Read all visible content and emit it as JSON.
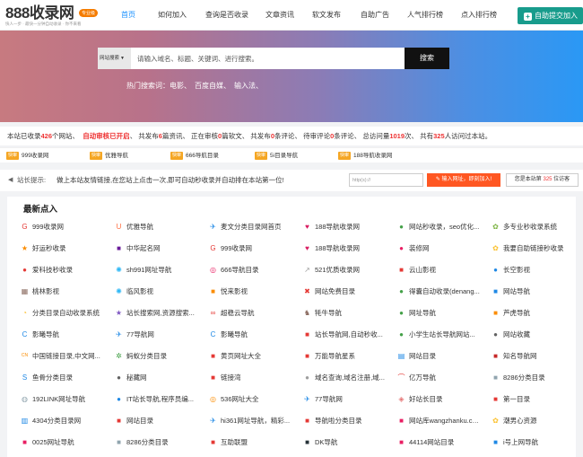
{
  "header": {
    "logo_text": "888收录网",
    "logo_badge": "专业级",
    "logo_slogan": "快人一步 · 最快一分钟自动收录 · 你不来看",
    "nav": [
      "首页",
      "如何加入",
      "查询是否收录",
      "文章资讯",
      "软文发布",
      "自助广告",
      "人气排行榜",
      "点入排行榜"
    ],
    "submit_label": "自助提交加入",
    "accent": "#1890ff",
    "submit_color": "#189c8c"
  },
  "search": {
    "type": "网站搜索",
    "placeholder": "请输入域名、标题、关键词、进行搜索。",
    "button": "搜索",
    "hot_label": "热门搜索词：",
    "hot_terms": [
      "电影、",
      "百度自媒、",
      "输入法、"
    ]
  },
  "stats": {
    "p1": "本站已收录",
    "sites": "426",
    "p2": "个网站、",
    "audit": "自动审核已开启",
    "p3": "、 共发布",
    "articles": "6",
    "p4": "篇资讯、 正在审核",
    "reviewing": "0",
    "p5": "篇软文、 共发布",
    "comments": "0",
    "p6": "条评论、 待审评论",
    "pending": "0",
    "p7": "条评论、 总访问量",
    "visits": "1019",
    "p8": "次、 共有",
    "visitors": "325",
    "p9": "人访问过本站。"
  },
  "strip": [
    {
      "tag": "快审",
      "text": "999收录网"
    },
    {
      "tag": "快审",
      "text": "优雅导航"
    },
    {
      "tag": "快审",
      "text": "666导航目录"
    },
    {
      "tag": "快审",
      "text": "5i目录导航"
    },
    {
      "tag": "快审",
      "text": "188导航收录网"
    }
  ],
  "notice": {
    "label": "站长提示:",
    "text": "做上本站友情链接,在您站上点击一次,即可自动秒收录并自动排在本站第一位!",
    "input_placeholder": "http(s)://",
    "btn": "输入网址，即刻加入!",
    "btn2_a": "您是本站第",
    "btn2_n": "325",
    "btn2_b": "位访客"
  },
  "latest": {
    "title": "最新点入",
    "items": [
      {
        "text": "999收录网",
        "icon": "g-icon",
        "color": "#e53935"
      },
      {
        "text": "优雅导航",
        "icon": "u-icon",
        "color": "#ff7043"
      },
      {
        "text": "麦文分类目录网首页",
        "icon": "plane-icon",
        "color": "#1e88e5"
      },
      {
        "text": "188导航收录网",
        "icon": "heart-icon",
        "color": "#d81b60"
      },
      {
        "text": "网站秒收录，seo优化...",
        "icon": "circle-icon",
        "color": "#43a047"
      },
      {
        "text": "多专业秒收录系统",
        "icon": "leaf-icon",
        "color": "#7cb342"
      },
      {
        "text": "好运秒收录",
        "icon": "star-icon",
        "color": "#fb8c00"
      },
      {
        "text": "中华起名网",
        "icon": "square-icon",
        "color": "#6a1b9a"
      },
      {
        "text": "999收录网",
        "icon": "g-icon",
        "color": "#e53935"
      },
      {
        "text": "188导航收录网",
        "icon": "heart-icon",
        "color": "#d81b60"
      },
      {
        "text": "装修网",
        "icon": "circle-icon",
        "color": "#e91e63"
      },
      {
        "text": "我要自助链接秒收录",
        "icon": "leaf-icon",
        "color": "#fbc02d"
      },
      {
        "text": "爱科技秒收录",
        "icon": "dot-icon",
        "color": "#e53935"
      },
      {
        "text": "sh991网址导航",
        "icon": "gear-icon",
        "color": "#29b6f6"
      },
      {
        "text": "666导航目录",
        "icon": "ring-icon",
        "color": "#e91e63"
      },
      {
        "text": "521优质收录网",
        "icon": "arrow-icon",
        "color": "#9e9e9e"
      },
      {
        "text": "云山影视",
        "icon": "square-icon",
        "color": "#e53935"
      },
      {
        "text": "长空影视",
        "icon": "circle-icon",
        "color": "#1e88e5"
      },
      {
        "text": "桃林影视",
        "icon": "grid-icon",
        "color": "#8d6e63"
      },
      {
        "text": "临风影视",
        "icon": "gear-icon",
        "color": "#29b6f6"
      },
      {
        "text": "悦来影视",
        "icon": "square-icon",
        "color": "#fb8c00"
      },
      {
        "text": "网站免费目录",
        "icon": "ex-icon",
        "color": "#e53935"
      },
      {
        "text": "得囊自动收录(denang...",
        "icon": "circle-icon",
        "color": "#43a047"
      },
      {
        "text": "网站导航",
        "icon": "square-icon",
        "color": "#1e88e5"
      },
      {
        "text": "分类目录自动收录系统",
        "icon": "pie-icon",
        "color": "#fbc02d"
      },
      {
        "text": "站长搜索网,资源搜索...",
        "icon": "star-icon",
        "color": "#7e57c2"
      },
      {
        "text": "超稳云导航",
        "icon": "link-icon",
        "color": "#e53935"
      },
      {
        "text": "牦牛导航",
        "icon": "bull-icon",
        "color": "#8d6e63"
      },
      {
        "text": "网址导航",
        "icon": "circle-icon",
        "color": "#43a047"
      },
      {
        "text": "芦虎导航",
        "icon": "square-icon",
        "color": "#fb8c00"
      },
      {
        "text": "影曦导航",
        "icon": "c-icon",
        "color": "#1e88e5"
      },
      {
        "text": "77导航网",
        "icon": "plane-icon",
        "color": "#1e88e5"
      },
      {
        "text": "影曦导航",
        "icon": "c-icon",
        "color": "#1e88e5"
      },
      {
        "text": "站长导航网,自动秒收...",
        "icon": "square-icon",
        "color": "#e53935"
      },
      {
        "text": "小学生站长导航网站...",
        "icon": "circle-icon",
        "color": "#43a047"
      },
      {
        "text": "网站收藏",
        "icon": "circle-icon",
        "color": "#616161"
      },
      {
        "text": "中国链接目录,中文网...",
        "icon": "cn-icon",
        "color": "#fb8c00"
      },
      {
        "text": "蚂蚁分类目录",
        "icon": "ant-icon",
        "color": "#43a047"
      },
      {
        "text": "黄页网址大全",
        "icon": "square-icon",
        "color": "#e53935"
      },
      {
        "text": "万能导航星系",
        "icon": "square-icon",
        "color": "#e53935"
      },
      {
        "text": "网站目录",
        "icon": "bars-icon",
        "color": "#1e88e5"
      },
      {
        "text": "知名导航网",
        "icon": "square-icon",
        "color": "#c62828"
      },
      {
        "text": "鱼骨分类目录",
        "icon": "s-icon",
        "color": "#1e88e5"
      },
      {
        "text": "秘藏网",
        "icon": "dot-icon",
        "color": "#616161"
      },
      {
        "text": "链接湾",
        "icon": "square-icon",
        "color": "#e53935"
      },
      {
        "text": "域名查询,域名注册,域...",
        "icon": "dot-icon",
        "color": "#9e9e9e"
      },
      {
        "text": "亿万导航",
        "icon": "curve-icon",
        "color": "#e53935"
      },
      {
        "text": "8286分类目录",
        "icon": "square-icon",
        "color": "#90a4ae"
      },
      {
        "text": "192LINK网址导航",
        "icon": "globe-icon",
        "color": "#90a4ae"
      },
      {
        "text": "IT站长导航,程序员编...",
        "icon": "circle-icon",
        "color": "#1e88e5"
      },
      {
        "text": "536网址大全",
        "icon": "ring-icon",
        "color": "#fb8c00"
      },
      {
        "text": "77导航网",
        "icon": "plane-icon",
        "color": "#1e88e5"
      },
      {
        "text": "好站长目录",
        "icon": "shield-icon",
        "color": "#e57373"
      },
      {
        "text": "第一目录",
        "icon": "square-icon",
        "color": "#e53935"
      },
      {
        "text": "4304分类目录网",
        "icon": "chart-icon",
        "color": "#1e88e5"
      },
      {
        "text": "网站目录",
        "icon": "square-icon",
        "color": "#e53935"
      },
      {
        "text": "hi361网址导航，精彩...",
        "icon": "plane-icon",
        "color": "#1e88e5"
      },
      {
        "text": "导航啦分类目录",
        "icon": "square-icon",
        "color": "#e53935"
      },
      {
        "text": "网站库wangzhanku.cn...",
        "icon": "square-icon",
        "color": "#e91e63"
      },
      {
        "text": "潮男心资源",
        "icon": "leaf-icon",
        "color": "#fbc02d"
      },
      {
        "text": "0025网址导航",
        "icon": "square-icon",
        "color": "#e91e63"
      },
      {
        "text": "8286分类目录",
        "icon": "square-icon",
        "color": "#90a4ae"
      },
      {
        "text": "互助联盟",
        "icon": "square-icon",
        "color": "#e53935"
      },
      {
        "text": "DK导航",
        "icon": "square-icon",
        "color": "#263238"
      },
      {
        "text": "44114网站目录",
        "icon": "square-icon",
        "color": "#e91e63"
      },
      {
        "text": "i号上网导航",
        "icon": "square-icon",
        "color": "#1e88e5"
      }
    ]
  }
}
